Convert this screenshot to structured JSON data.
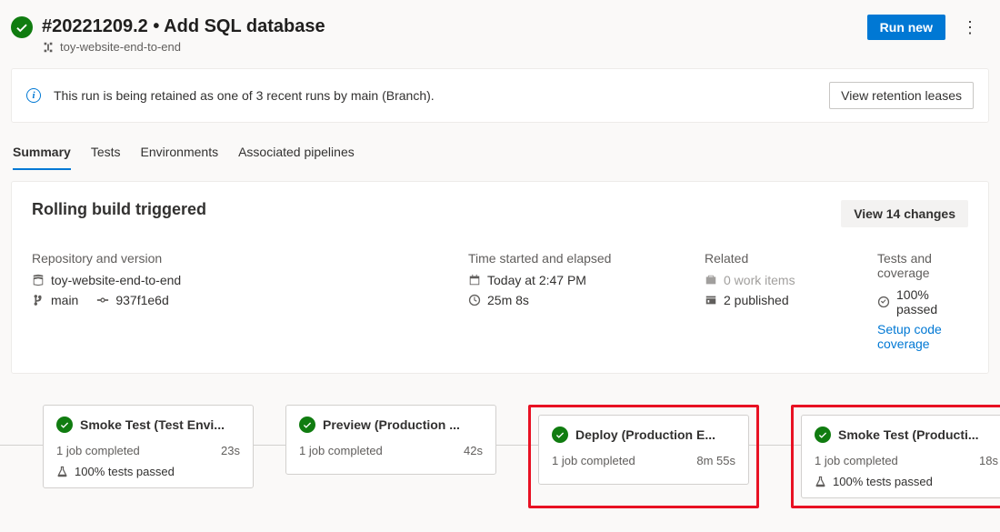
{
  "header": {
    "title": "#20221209.2 • Add SQL database",
    "pipeline_name": "toy-website-end-to-end",
    "run_new_label": "Run new"
  },
  "retention_bar": {
    "message": "This run is being retained as one of 3 recent runs by main (Branch).",
    "button_label": "View retention leases"
  },
  "tabs": [
    {
      "id": "summary",
      "label": "Summary",
      "active": true
    },
    {
      "id": "tests",
      "label": "Tests",
      "active": false
    },
    {
      "id": "environments",
      "label": "Environments",
      "active": false
    },
    {
      "id": "associated",
      "label": "Associated pipelines",
      "active": false
    }
  ],
  "summary": {
    "heading": "Rolling build triggered",
    "changes_button": "View 14 changes",
    "repo": {
      "label": "Repository and version",
      "name": "toy-website-end-to-end",
      "branch": "main",
      "commit": "937f1e6d"
    },
    "time": {
      "label": "Time started and elapsed",
      "started": "Today at 2:47 PM",
      "elapsed": "25m 8s"
    },
    "related": {
      "label": "Related",
      "work_items": "0 work items",
      "published": "2 published"
    },
    "tests": {
      "label": "Tests and coverage",
      "passed": "100% passed",
      "coverage_link": "Setup code coverage"
    }
  },
  "stages": [
    {
      "name": "Smoke Test (Test Envi...",
      "jobs": "1 job completed",
      "duration": "23s",
      "tests": "100% tests passed",
      "highlighted": false
    },
    {
      "name": "Preview (Production ...",
      "jobs": "1 job completed",
      "duration": "42s",
      "tests": null,
      "highlighted": false
    },
    {
      "name": "Deploy (Production E...",
      "jobs": "1 job completed",
      "duration": "8m 55s",
      "tests": null,
      "highlighted": true
    },
    {
      "name": "Smoke Test (Producti...",
      "jobs": "1 job completed",
      "duration": "18s",
      "tests": "100% tests passed",
      "highlighted": true
    }
  ]
}
